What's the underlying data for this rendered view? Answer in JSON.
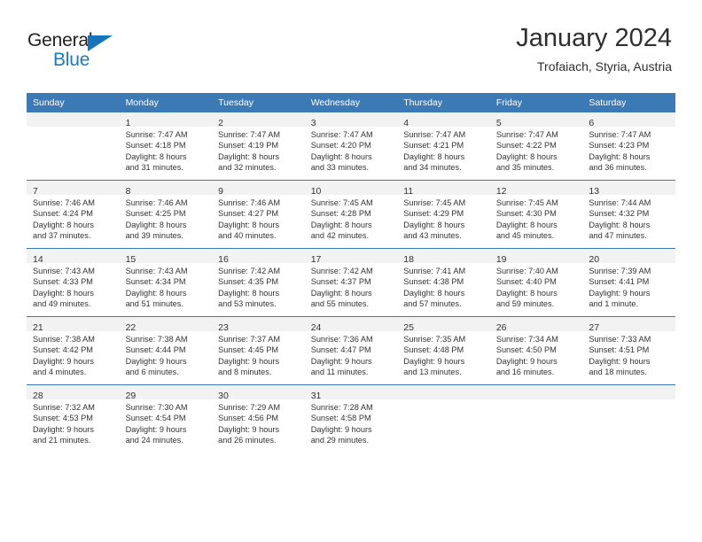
{
  "brand": {
    "name_part1": "General",
    "name_part2": "Blue",
    "triangle_icon": "triangle-icon",
    "color_dark": "#231f20",
    "color_blue": "#1b7ac4"
  },
  "header": {
    "title": "January 2024",
    "subtitle": "Trofaiach, Styria, Austria"
  },
  "theme": {
    "header_blue": "#3b7ab5",
    "daynum_band": "#f2f2f2",
    "text": "#333333"
  },
  "weekday_headers": [
    "Sunday",
    "Monday",
    "Tuesday",
    "Wednesday",
    "Thursday",
    "Friday",
    "Saturday"
  ],
  "weeks": [
    [
      {
        "day": "",
        "lines": []
      },
      {
        "day": "1",
        "lines": [
          "Sunrise: 7:47 AM",
          "Sunset: 4:18 PM",
          "Daylight: 8 hours",
          "and 31 minutes."
        ]
      },
      {
        "day": "2",
        "lines": [
          "Sunrise: 7:47 AM",
          "Sunset: 4:19 PM",
          "Daylight: 8 hours",
          "and 32 minutes."
        ]
      },
      {
        "day": "3",
        "lines": [
          "Sunrise: 7:47 AM",
          "Sunset: 4:20 PM",
          "Daylight: 8 hours",
          "and 33 minutes."
        ]
      },
      {
        "day": "4",
        "lines": [
          "Sunrise: 7:47 AM",
          "Sunset: 4:21 PM",
          "Daylight: 8 hours",
          "and 34 minutes."
        ]
      },
      {
        "day": "5",
        "lines": [
          "Sunrise: 7:47 AM",
          "Sunset: 4:22 PM",
          "Daylight: 8 hours",
          "and 35 minutes."
        ]
      },
      {
        "day": "6",
        "lines": [
          "Sunrise: 7:47 AM",
          "Sunset: 4:23 PM",
          "Daylight: 8 hours",
          "and 36 minutes."
        ]
      }
    ],
    [
      {
        "day": "7",
        "lines": [
          "Sunrise: 7:46 AM",
          "Sunset: 4:24 PM",
          "Daylight: 8 hours",
          "and 37 minutes."
        ]
      },
      {
        "day": "8",
        "lines": [
          "Sunrise: 7:46 AM",
          "Sunset: 4:25 PM",
          "Daylight: 8 hours",
          "and 39 minutes."
        ]
      },
      {
        "day": "9",
        "lines": [
          "Sunrise: 7:46 AM",
          "Sunset: 4:27 PM",
          "Daylight: 8 hours",
          "and 40 minutes."
        ]
      },
      {
        "day": "10",
        "lines": [
          "Sunrise: 7:45 AM",
          "Sunset: 4:28 PM",
          "Daylight: 8 hours",
          "and 42 minutes."
        ]
      },
      {
        "day": "11",
        "lines": [
          "Sunrise: 7:45 AM",
          "Sunset: 4:29 PM",
          "Daylight: 8 hours",
          "and 43 minutes."
        ]
      },
      {
        "day": "12",
        "lines": [
          "Sunrise: 7:45 AM",
          "Sunset: 4:30 PM",
          "Daylight: 8 hours",
          "and 45 minutes."
        ]
      },
      {
        "day": "13",
        "lines": [
          "Sunrise: 7:44 AM",
          "Sunset: 4:32 PM",
          "Daylight: 8 hours",
          "and 47 minutes."
        ]
      }
    ],
    [
      {
        "day": "14",
        "lines": [
          "Sunrise: 7:43 AM",
          "Sunset: 4:33 PM",
          "Daylight: 8 hours",
          "and 49 minutes."
        ]
      },
      {
        "day": "15",
        "lines": [
          "Sunrise: 7:43 AM",
          "Sunset: 4:34 PM",
          "Daylight: 8 hours",
          "and 51 minutes."
        ]
      },
      {
        "day": "16",
        "lines": [
          "Sunrise: 7:42 AM",
          "Sunset: 4:35 PM",
          "Daylight: 8 hours",
          "and 53 minutes."
        ]
      },
      {
        "day": "17",
        "lines": [
          "Sunrise: 7:42 AM",
          "Sunset: 4:37 PM",
          "Daylight: 8 hours",
          "and 55 minutes."
        ]
      },
      {
        "day": "18",
        "lines": [
          "Sunrise: 7:41 AM",
          "Sunset: 4:38 PM",
          "Daylight: 8 hours",
          "and 57 minutes."
        ]
      },
      {
        "day": "19",
        "lines": [
          "Sunrise: 7:40 AM",
          "Sunset: 4:40 PM",
          "Daylight: 8 hours",
          "and 59 minutes."
        ]
      },
      {
        "day": "20",
        "lines": [
          "Sunrise: 7:39 AM",
          "Sunset: 4:41 PM",
          "Daylight: 9 hours",
          "and 1 minute."
        ]
      }
    ],
    [
      {
        "day": "21",
        "lines": [
          "Sunrise: 7:38 AM",
          "Sunset: 4:42 PM",
          "Daylight: 9 hours",
          "and 4 minutes."
        ]
      },
      {
        "day": "22",
        "lines": [
          "Sunrise: 7:38 AM",
          "Sunset: 4:44 PM",
          "Daylight: 9 hours",
          "and 6 minutes."
        ]
      },
      {
        "day": "23",
        "lines": [
          "Sunrise: 7:37 AM",
          "Sunset: 4:45 PM",
          "Daylight: 9 hours",
          "and 8 minutes."
        ]
      },
      {
        "day": "24",
        "lines": [
          "Sunrise: 7:36 AM",
          "Sunset: 4:47 PM",
          "Daylight: 9 hours",
          "and 11 minutes."
        ]
      },
      {
        "day": "25",
        "lines": [
          "Sunrise: 7:35 AM",
          "Sunset: 4:48 PM",
          "Daylight: 9 hours",
          "and 13 minutes."
        ]
      },
      {
        "day": "26",
        "lines": [
          "Sunrise: 7:34 AM",
          "Sunset: 4:50 PM",
          "Daylight: 9 hours",
          "and 16 minutes."
        ]
      },
      {
        "day": "27",
        "lines": [
          "Sunrise: 7:33 AM",
          "Sunset: 4:51 PM",
          "Daylight: 9 hours",
          "and 18 minutes."
        ]
      }
    ],
    [
      {
        "day": "28",
        "lines": [
          "Sunrise: 7:32 AM",
          "Sunset: 4:53 PM",
          "Daylight: 9 hours",
          "and 21 minutes."
        ]
      },
      {
        "day": "29",
        "lines": [
          "Sunrise: 7:30 AM",
          "Sunset: 4:54 PM",
          "Daylight: 9 hours",
          "and 24 minutes."
        ]
      },
      {
        "day": "30",
        "lines": [
          "Sunrise: 7:29 AM",
          "Sunset: 4:56 PM",
          "Daylight: 9 hours",
          "and 26 minutes."
        ]
      },
      {
        "day": "31",
        "lines": [
          "Sunrise: 7:28 AM",
          "Sunset: 4:58 PM",
          "Daylight: 9 hours",
          "and 29 minutes."
        ]
      },
      {
        "day": "",
        "lines": []
      },
      {
        "day": "",
        "lines": []
      },
      {
        "day": "",
        "lines": []
      }
    ]
  ]
}
